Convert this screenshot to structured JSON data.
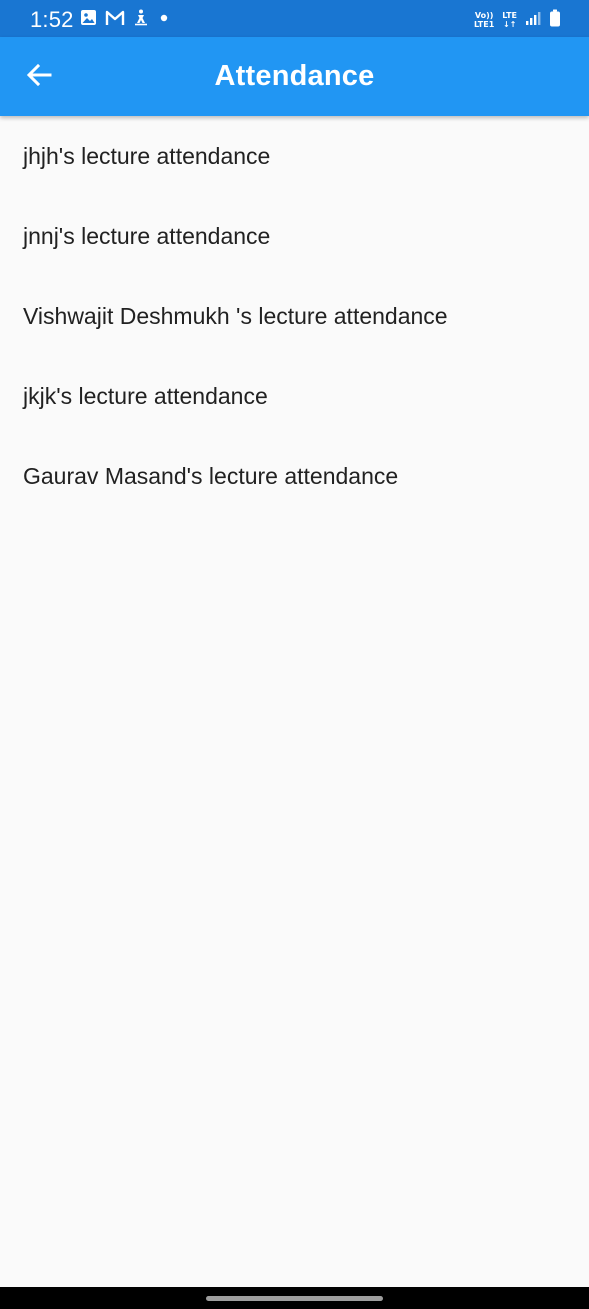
{
  "status_bar": {
    "time": "1:52",
    "left_icons": [
      "image-icon",
      "gmail-icon",
      "accessibility-icon",
      "dot-icon"
    ],
    "network": {
      "volte_top": "Vo))",
      "volte_bottom": "LTE1",
      "lte_top": "LTE",
      "lte_bottom": "↓↑"
    },
    "right_icons": [
      "signal-icon",
      "battery-icon"
    ],
    "background": "#1976d2"
  },
  "app_bar": {
    "title": "Attendance",
    "back_icon": "arrow-back-icon",
    "background": "#2196f3"
  },
  "attendance_list": {
    "items": [
      {
        "label": "jhjh's lecture attendance"
      },
      {
        "label": "jnnj's lecture attendance"
      },
      {
        "label": "Vishwajit Deshmukh 's lecture attendance"
      },
      {
        "label": "jkjk's lecture attendance"
      },
      {
        "label": "Gaurav Masand's lecture attendance"
      }
    ]
  },
  "colors": {
    "page_background": "#fafafa",
    "text_primary": "#212121",
    "nav_bar": "#000000"
  }
}
